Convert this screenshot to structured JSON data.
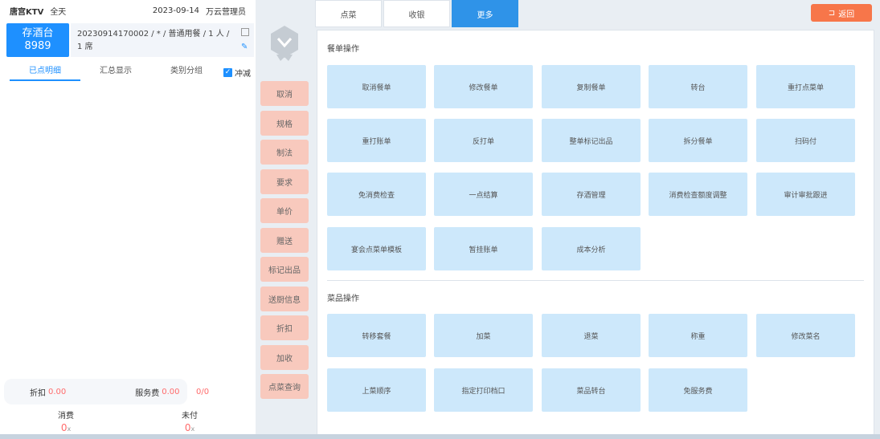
{
  "topbar": {
    "store": "唐宫KTV",
    "period": "全天",
    "date": "2023-09-14",
    "user": "万云营理员"
  },
  "table": {
    "name": "存酒台",
    "number": "8989",
    "order_info": "20230914170002 / * / 普通用餐 / 1 人 / 1 席"
  },
  "subtabs": [
    "已点明细",
    "汇总显示",
    "类别分组"
  ],
  "checkbox": {
    "label": "冲减",
    "checked": "✓"
  },
  "summary": {
    "discount_label": "折扣",
    "discount_value": "0.00",
    "service_label": "服务费",
    "service_value": "0.00",
    "ratio": "0/0",
    "consume_label": "消费",
    "consume_value": "0",
    "consume_unit": "x",
    "unpaid_label": "未付",
    "unpaid_value": "0",
    "unpaid_unit": "x"
  },
  "side_buttons": [
    "取消",
    "规格",
    "制法",
    "要求",
    "单价",
    "赠送",
    "标记出品",
    "送厨信息",
    "折扣",
    "加收",
    "点菜查询"
  ],
  "tabs": [
    "点菜",
    "收银",
    "更多"
  ],
  "back_button": "返回",
  "sections": {
    "order_ops": {
      "title": "餐单操作",
      "buttons": [
        "取消餐单",
        "修改餐单",
        "复制餐单",
        "转台",
        "重打点菜单",
        "重打账单",
        "反打单",
        "整单标记出品",
        "拆分餐单",
        "扫码付",
        "免消费检查",
        "一点结算",
        "存酒管理",
        "消费检查额度调整",
        "审计审批跟进",
        "宴会点菜单模板",
        "暂挂账单",
        "成本分析"
      ]
    },
    "dish_ops": {
      "title": "菜品操作",
      "buttons": [
        "转移套餐",
        "加菜",
        "退菜",
        "称重",
        "修改菜名",
        "上菜顺序",
        "指定打印档口",
        "菜品转台",
        "免服务费"
      ]
    }
  }
}
